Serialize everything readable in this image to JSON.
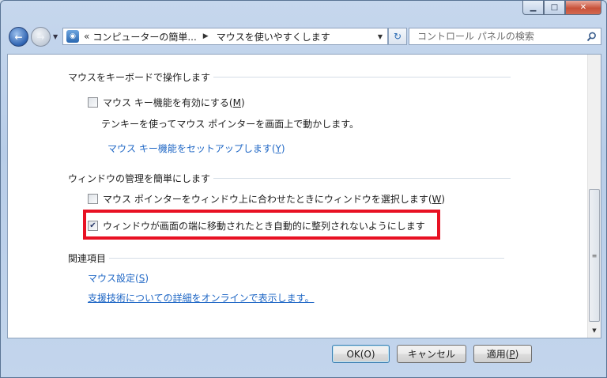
{
  "window": {
    "caption_buttons": {
      "minimize": "▁",
      "maximize": "□",
      "close": "✕"
    }
  },
  "nav": {
    "back_glyph": "←",
    "forward_glyph": "→",
    "address": {
      "overflow_glyph": "«",
      "breadcrumb_1": "コンピューターの簡単...",
      "breadcrumb_2": "マウスを使いやすくします"
    },
    "refresh_glyph": "↻",
    "search_placeholder": "コントロール パネルの検索"
  },
  "sections": {
    "keyboard": {
      "heading": "マウスをキーボードで操作します",
      "checkbox_label": "マウス キー機能を有効にする(",
      "checkbox_key": "M",
      "checkbox_close": ")",
      "checked": false,
      "description": "テンキーを使ってマウス ポインターを画面上で動かします。",
      "setup_link": "マウス キー機能をセットアップします(",
      "setup_key": "Y",
      "setup_close": ")"
    },
    "window_mgmt": {
      "heading": "ウィンドウの管理を簡単にします",
      "hover_label": "マウス ポインターをウィンドウ上に合わせたときにウィンドウを選択します(",
      "hover_key": "W",
      "hover_close": ")",
      "hover_checked": false,
      "snap_label": "ウィンドウが画面の端に移動されたとき自動的に整列されないようにします",
      "snap_checked": true
    },
    "related": {
      "heading": "関連項目",
      "mouse_settings": "マウス設定(",
      "mouse_settings_key": "S",
      "mouse_settings_close": ")",
      "online_help": "支援技術についての詳細をオンラインで表示します。"
    }
  },
  "footer": {
    "ok": "OK(O)",
    "cancel": "キャンセル",
    "apply_prefix": "適用(",
    "apply_key": "P",
    "apply_close": ")"
  },
  "colors": {
    "link": "#1f67c5",
    "highlight": "#e81123"
  }
}
